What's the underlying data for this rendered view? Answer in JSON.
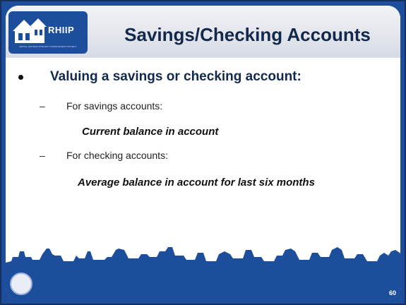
{
  "header": {
    "logo": {
      "text": "RHIIP",
      "subtext": "RENTAL HOUSING INTEGRITY IMPROVEMENT PROJECT"
    },
    "title": "Savings/Checking Accounts"
  },
  "body": {
    "bullet": "Valuing a savings or checking account:",
    "items": [
      {
        "dash": "–",
        "label": "For savings accounts:",
        "emphasis": "Current balance in account"
      },
      {
        "dash": "–",
        "label": "For checking accounts:",
        "emphasis": "Average balance in account for last six months"
      }
    ]
  },
  "footer": {
    "page_number": "60"
  },
  "colors": {
    "brand_blue": "#1d4e9b",
    "title_navy": "#13294b"
  }
}
